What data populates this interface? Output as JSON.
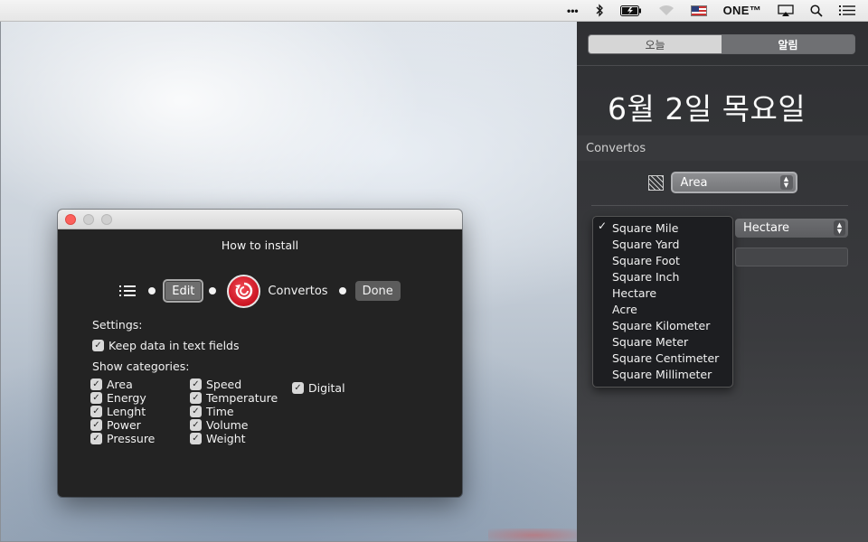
{
  "menubar": {
    "overflow_label": "•••",
    "status_text": "ONE™",
    "icons": [
      "overflow-dots-icon",
      "bluetooth-icon",
      "battery-icon",
      "wifi-icon",
      "us-flag-icon",
      "airplay-icon",
      "search-icon",
      "notification-list-icon"
    ]
  },
  "notification_center": {
    "tabs": [
      {
        "label": "오늘",
        "active": false
      },
      {
        "label": "알림",
        "active": true
      }
    ],
    "date": "6월 2일 목요일",
    "widget": {
      "title": "Convertos",
      "category_selected": "Area",
      "units": [
        {
          "label": "Square Mile",
          "checked": true
        },
        {
          "label": "Square Yard",
          "checked": false
        },
        {
          "label": "Square Foot",
          "checked": false
        },
        {
          "label": "Square Inch",
          "checked": false
        },
        {
          "label": "Hectare",
          "checked": false
        },
        {
          "label": "Acre",
          "checked": false
        },
        {
          "label": "Square Kilometer",
          "checked": false
        },
        {
          "label": "Square Meter",
          "checked": false
        },
        {
          "label": "Square Centimeter",
          "checked": false
        },
        {
          "label": "Square Millimeter",
          "checked": false
        }
      ],
      "target_unit": "Hectare",
      "value": ""
    }
  },
  "install_window": {
    "title": "How to install",
    "steps": {
      "edit_label": "Edit",
      "app_label": "Convertos",
      "done_label": "Done"
    },
    "settings_heading": "Settings:",
    "keep_data_label": "Keep data in text fields",
    "show_categories_heading": "Show categories:",
    "categories": {
      "col1": [
        "Area",
        "Energy",
        "Lenght",
        "Power",
        "Pressure"
      ],
      "col2": [
        "Speed",
        "Temperature",
        "Time",
        "Volume",
        "Weight"
      ],
      "col3": [
        "Digital"
      ]
    }
  },
  "colors": {
    "close_button": "#fc605c",
    "app_icon": "#d41c28",
    "panel_bg": "#333437"
  }
}
